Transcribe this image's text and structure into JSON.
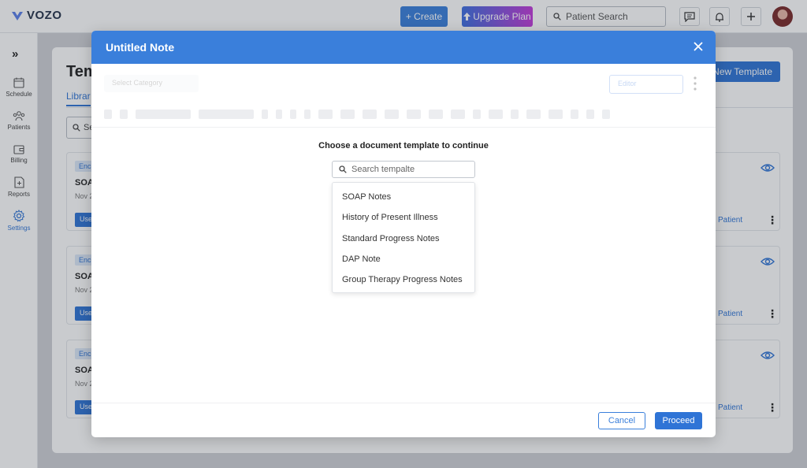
{
  "app": {
    "logo_text": "VOZO",
    "brand_color": "#3a7fdb"
  },
  "topbar": {
    "create_label": "+ Create",
    "upgrade_label": "Upgrade Plan",
    "search_placeholder": "Patient Search",
    "icons": [
      "chat-icon",
      "bell-icon",
      "plus-icon",
      "avatar"
    ]
  },
  "sidebar": {
    "items": [
      {
        "label": "Schedule",
        "icon": "calendar-icon"
      },
      {
        "label": "Patients",
        "icon": "users-icon"
      },
      {
        "label": "Billing",
        "icon": "wallet-icon"
      },
      {
        "label": "Reports",
        "icon": "report-icon"
      },
      {
        "label": "Settings",
        "icon": "gear-icon",
        "active": true
      }
    ]
  },
  "background": {
    "title": "Tem",
    "tab": "Librar",
    "search_text": "Se",
    "new_template_label": "New Template",
    "cards": [
      {
        "badge": "Enc",
        "name": "SOA",
        "date": "Nov 2",
        "use_label": "Use",
        "patient_label": "Patient"
      },
      {
        "badge": "Enc",
        "name": "SOA",
        "date": "Nov 2",
        "use_label": "Use",
        "patient_label": "Patient"
      },
      {
        "badge": "Enc",
        "name": "SOA",
        "date": "Nov 2",
        "use_label": "Use",
        "patient_label": "Patient"
      }
    ]
  },
  "modal": {
    "title": "Untitled Note",
    "faded_category_placeholder": "Select Category",
    "faded_editor_select": "Editor",
    "prompt": "Choose a document template to continue",
    "search_placeholder": "Search tempalte",
    "templates": [
      "SOAP Notes",
      "History of Present Illness",
      "Standard Progress Notes",
      "DAP Note",
      "Group Therapy Progress Notes"
    ],
    "cancel_label": "Cancel",
    "proceed_label": "Proceed"
  }
}
